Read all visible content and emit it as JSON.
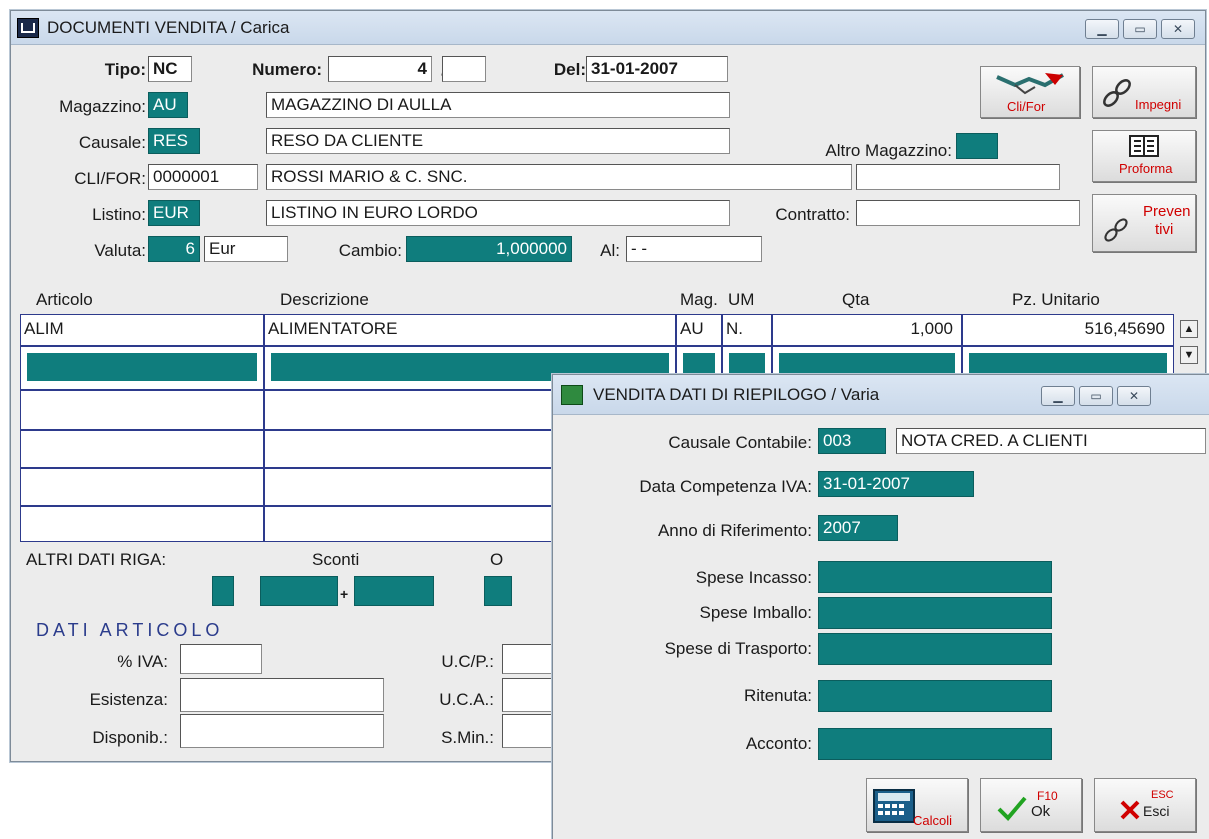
{
  "main_window": {
    "title": "DOCUMENTI VENDITA / Carica",
    "tipo_label": "Tipo:",
    "tipo_value": "NC",
    "numero_label": "Numero:",
    "numero_value": "4",
    "numero_sep": "/",
    "numero_suffix": "",
    "del_label": "Del:",
    "del_value": "31-01-2007",
    "magazzino_label": "Magazzino:",
    "magazzino_code": "AU",
    "magazzino_desc": "MAGAZZINO DI AULLA",
    "causale_label": "Causale:",
    "causale_code": "RES",
    "causale_desc": "RESO DA CLIENTE",
    "altro_magazzino_label": "Altro Magazzino:",
    "altro_magazzino_value": "",
    "clifor_label": "CLI/FOR:",
    "clifor_code": "0000001",
    "clifor_desc": "ROSSI MARIO & C. SNC.",
    "clifor_extra": "",
    "listino_label": "Listino:",
    "listino_code": "EUR",
    "listino_desc": "LISTINO IN EURO LORDO",
    "contratto_label": "Contratto:",
    "contratto_value": "",
    "valuta_label": "Valuta:",
    "valuta_code": "6",
    "valuta_sym": "Eur",
    "cambio_label": "Cambio:",
    "cambio_value": "1,000000",
    "al_label": "Al:",
    "al_value": "- -",
    "buttons": {
      "clifor": "Cli/For",
      "impegni": "Impegni",
      "proforma": "Proforma",
      "preventivi_1": "Preven",
      "preventivi_2": "tivi"
    },
    "grid_headers": {
      "articolo": "Articolo",
      "descrizione": "Descrizione",
      "mag": "Mag.",
      "um": "UM",
      "qta": "Qta",
      "pz_unitario": "Pz. Unitario"
    },
    "grid_rows": [
      {
        "articolo": "ALIM",
        "descrizione": "ALIMENTATORE",
        "mag": "AU",
        "um": "N.",
        "qta": "1,000",
        "pz": "516,45690"
      }
    ],
    "altri_dati_riga_label": "ALTRI DATI RIGA:",
    "sconti_label": "Sconti",
    "o_label": "O",
    "sconto_plus": "+",
    "dati_articolo_label": "DATI ARTICOLO",
    "iva_label": "% IVA:",
    "esistenza_label": "Esistenza:",
    "disponib_label": "Disponib.:",
    "ucp_label": "U.C/P.:",
    "uca_label": "U.C.A.:",
    "smin_label": "S.Min.:"
  },
  "dialog": {
    "title": "VENDITA DATI DI RIEPILOGO / Varia",
    "causale_contabile_label": "Causale Contabile:",
    "causale_contabile_code": "003",
    "causale_contabile_desc": "NOTA CRED. A CLIENTI",
    "data_competenza_label": "Data Competenza IVA:",
    "data_competenza_value": "31-01-2007",
    "anno_riferimento_label": "Anno di Riferimento:",
    "anno_riferimento_value": "2007",
    "spese_incasso_label": "Spese Incasso:",
    "spese_imballo_label": "Spese Imballo:",
    "spese_trasporto_label": "Spese di Trasporto:",
    "ritenuta_label": "Ritenuta:",
    "acconto_label": "Acconto:",
    "calcoli_label": "Calcoli",
    "ok_key": "F10",
    "ok_label": "Ok",
    "esci_key": "ESC",
    "esci_label": "Esci"
  },
  "colors": {
    "teal": "#0f7d7d",
    "grid_border": "#2d3a8c",
    "red_text": "#d00000"
  }
}
